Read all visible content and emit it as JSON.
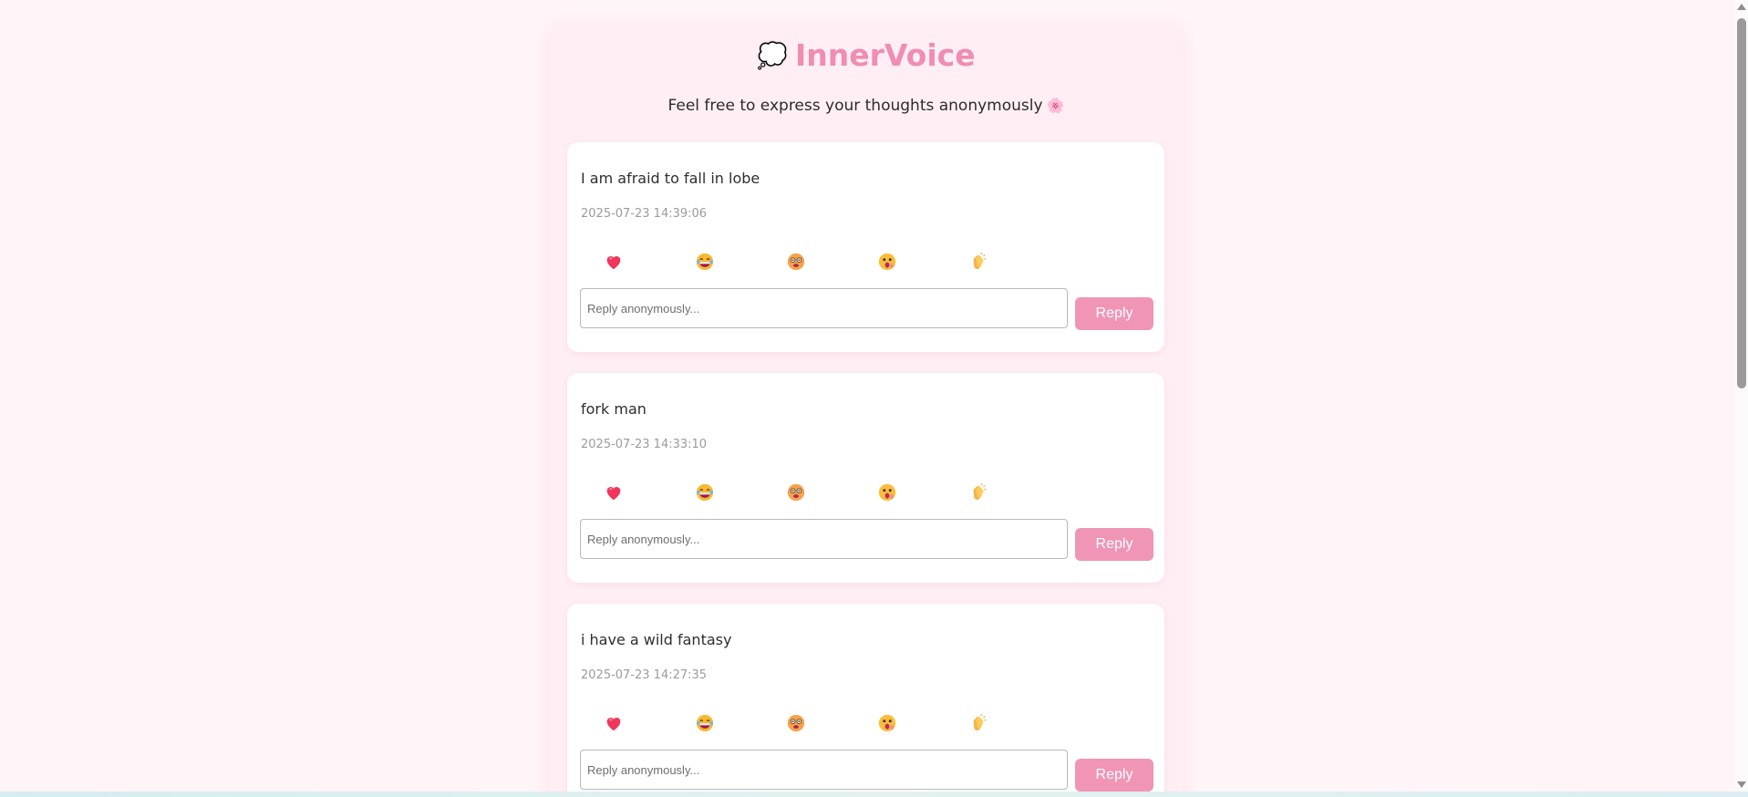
{
  "header": {
    "logo_icon": "thought-bubble-icon",
    "logo_glyph": "💭",
    "title": "InnerVoice",
    "subtitle": "Feel free to express your thoughts anonymously",
    "subtitle_icon": "flower-icon",
    "subtitle_glyph": "🌸"
  },
  "colors": {
    "page_background": "#fff4f7",
    "container_background": "#ffeff4",
    "accent_pink": "#f08db1",
    "button_pink": "#f095b6"
  },
  "reaction_icons": [
    "heart-icon",
    "laughing-face-icon",
    "dizzy-face-icon",
    "shocked-face-icon",
    "clapping-hands-icon"
  ],
  "posts": [
    {
      "text": "I am afraid to fall in lobe",
      "timestamp": "2025-07-23 14:39:06",
      "reply_placeholder": "Reply anonymously...",
      "reply_label": "Reply"
    },
    {
      "text": "fork man",
      "timestamp": "2025-07-23 14:33:10",
      "reply_placeholder": "Reply anonymously...",
      "reply_label": "Reply"
    },
    {
      "text": "i have a wild fantasy",
      "timestamp": "2025-07-23 14:27:35",
      "reply_placeholder": "Reply anonymously...",
      "reply_label": "Reply"
    }
  ]
}
